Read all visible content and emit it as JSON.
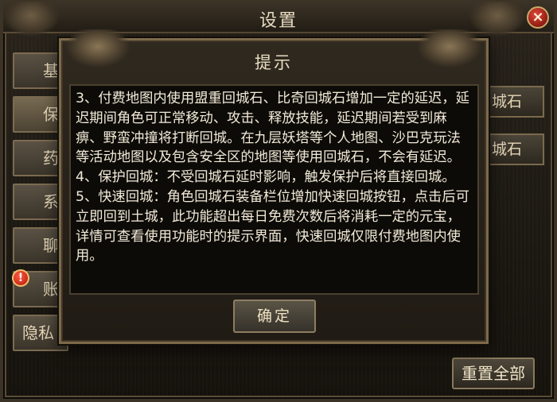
{
  "window": {
    "title": "设置",
    "close_glyph": "×"
  },
  "tabs": [
    {
      "label": "基"
    },
    {
      "label": "保"
    },
    {
      "label": "药"
    },
    {
      "label": "系"
    },
    {
      "label": "聊"
    },
    {
      "label": "账"
    },
    {
      "label": "隐私"
    }
  ],
  "alert_badge": "!",
  "side_buttons": [
    {
      "label": "城石"
    },
    {
      "label": "城石"
    }
  ],
  "reset_button": "重置全部",
  "dialog": {
    "title": "提示",
    "paragraphs": [
      "3、付费地图内使用盟重回城石、比奇回城石增加一定的延迟，延迟期间角色可正常移动、攻击、释放技能，延迟期间若受到麻痹、野蛮冲撞将打断回城。在九层妖塔等个人地图、沙巴克玩法等活动地图以及包含安全区的地图等使用回城石，不会有延迟。",
      "4、保护回城：不受回城石延时影响，触发保护后将直接回城。",
      "5、快速回城：角色回城石装备栏位增加快速回城按钮，点击后可立即回到土城，此功能超出每日免费次数后将消耗一定的元宝，详情可查看使用功能时的提示界面，快速回城仅限付费地图内使用。"
    ],
    "confirm_label": "确定"
  },
  "icons": {
    "close": "close-icon",
    "alert": "alert-icon"
  }
}
